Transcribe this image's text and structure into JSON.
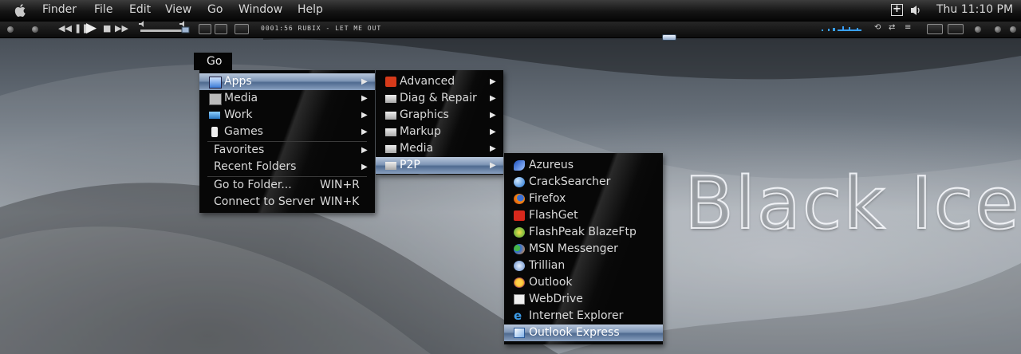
{
  "menubar": {
    "items": [
      "Finder",
      "File",
      "Edit",
      "View",
      "Go",
      "Window",
      "Help"
    ],
    "clock": "Thu 11:10 PM",
    "icons": [
      "apple-icon",
      "add-icon",
      "volume-icon"
    ]
  },
  "media_player": {
    "track_text": "0001:56 RUBIX - LET ME OUT",
    "buttons": [
      "rewind",
      "pause",
      "play",
      "stop",
      "fast-forward"
    ]
  },
  "go_menu_title": "Go",
  "go_menu": {
    "items": [
      {
        "label": "Apps",
        "icon": "apps-icon",
        "submenu": true,
        "selected": true
      },
      {
        "label": "Media",
        "icon": "media-icon",
        "submenu": true
      },
      {
        "label": "Work",
        "icon": "work-icon",
        "submenu": true
      },
      {
        "label": "Games",
        "icon": "games-icon",
        "submenu": true
      },
      {
        "label": "Favorites",
        "submenu": true
      },
      {
        "label": "Recent Folders",
        "submenu": true
      },
      {
        "label": "Go to Folder...",
        "shortcut": "WIN+R"
      },
      {
        "label": "Connect to Server",
        "shortcut": "WIN+K"
      }
    ]
  },
  "apps_menu": {
    "items": [
      {
        "label": "Advanced",
        "icon": "power-icon",
        "submenu": true
      },
      {
        "label": "Diag & Repair",
        "icon": "folder-icon",
        "submenu": true
      },
      {
        "label": "Graphics",
        "icon": "folder-icon",
        "submenu": true
      },
      {
        "label": "Markup",
        "icon": "folder-icon",
        "submenu": true
      },
      {
        "label": "Media",
        "icon": "folder-icon",
        "submenu": true
      },
      {
        "label": "P2P",
        "icon": "folder-icon",
        "submenu": true,
        "selected": true
      }
    ]
  },
  "p2p_menu": {
    "items": [
      {
        "label": "Azureus",
        "icon": "azureus-icon"
      },
      {
        "label": "CrackSearcher",
        "icon": "globe-icon"
      },
      {
        "label": "Firefox",
        "icon": "firefox-icon"
      },
      {
        "label": "FlashGet",
        "icon": "flashget-icon"
      },
      {
        "label": "FlashPeak BlazeFtp",
        "icon": "blazeftp-icon"
      },
      {
        "label": "MSN Messenger",
        "icon": "msn-icon"
      },
      {
        "label": "Trillian",
        "icon": "trillian-icon"
      },
      {
        "label": "Outlook",
        "icon": "outlook-icon"
      },
      {
        "label": "WebDrive",
        "icon": "webdrive-icon"
      },
      {
        "label": "Internet Explorer",
        "icon": "ie-icon"
      },
      {
        "label": "Outlook Express",
        "icon": "outlook-express-icon",
        "selected": true
      }
    ]
  },
  "wallpaper": {
    "text": "Black Ice"
  },
  "colors": {
    "selection": "#7f96b6",
    "menu_bg": "#070707",
    "menubar_bg": "#151515"
  }
}
